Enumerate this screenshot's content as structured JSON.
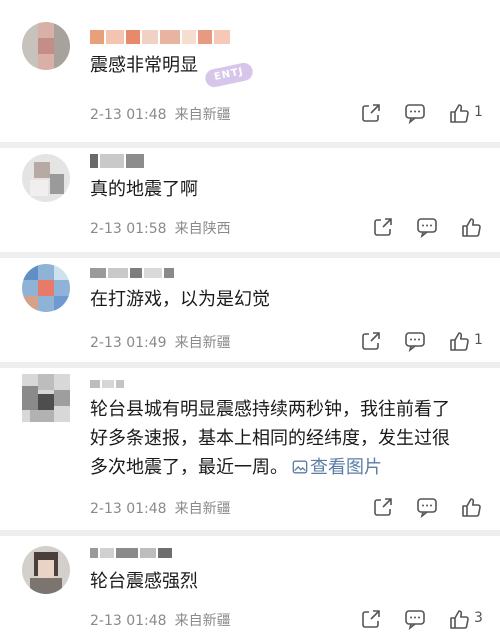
{
  "comments": [
    {
      "text": "震感非常明显",
      "date": "2-13 01:48",
      "location": "来自新疆",
      "likes": "1",
      "badge": "ENTJ"
    },
    {
      "text": "真的地震了啊",
      "date": "2-13 01:58",
      "location": "来自陕西",
      "likes": ""
    },
    {
      "text": "在打游戏，以为是幻觉",
      "date": "2-13 01:49",
      "location": "来自新疆",
      "likes": "1"
    },
    {
      "text_lines": [
        "轮台县城有明显震感持续两秒钟，我往前看了",
        "好多条速报，基本上相同的经纬度，发生过很",
        "多次地震了，最近一周。"
      ],
      "view_image": "查看图片",
      "date": "2-13 01:48",
      "location": "来自新疆",
      "likes": ""
    },
    {
      "text": "轮台震感强烈",
      "date": "2-13 01:48",
      "location": "来自新疆",
      "likes": "3"
    }
  ],
  "colors": {
    "text": "#1a1a1a",
    "meta": "#8a8a8a",
    "link": "#5b7ea6",
    "separator": "#eeeeee"
  },
  "icons": [
    "share-icon",
    "comment-icon",
    "like-icon",
    "image-icon"
  ]
}
